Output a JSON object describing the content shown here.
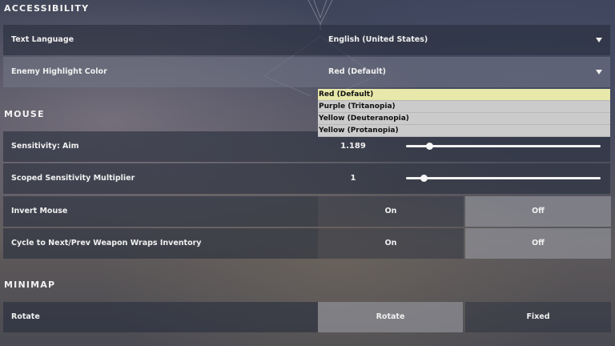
{
  "sections": {
    "accessibility": "ACCESSIBILITY",
    "mouse": "MOUSE",
    "minimap": "MINIMAP"
  },
  "accessibility": {
    "text_language": {
      "label": "Text Language",
      "value": "English (United States)"
    },
    "enemy_highlight": {
      "label": "Enemy Highlight Color",
      "value": "Red (Default)",
      "options": [
        "Red (Default)",
        "Purple (Tritanopia)",
        "Yellow (Deuteranopia)",
        "Yellow (Protanopia)"
      ]
    }
  },
  "mouse": {
    "sensitivity": {
      "label": "Sensitivity: Aim",
      "value": "1.189",
      "fraction": 0.12
    },
    "scoped": {
      "label": "Scoped Sensitivity Multiplier",
      "value": "1",
      "fraction": 0.09
    },
    "invert": {
      "label": "Invert Mouse",
      "on": "On",
      "off": "Off",
      "selected": "Off"
    },
    "cycle": {
      "label": "Cycle to Next/Prev Weapon Wraps Inventory",
      "on": "On",
      "off": "Off",
      "selected": "Off"
    }
  },
  "minimap": {
    "rotate": {
      "label": "Rotate",
      "opt1": "Rotate",
      "opt2": "Fixed",
      "selected": "Rotate"
    }
  },
  "colors": {
    "dropdown_selected": "#e7e8a9",
    "dropdown_bg": "#cbcbcb",
    "row_bg": "#282e3e"
  },
  "icons": [
    "caret-down-icon"
  ]
}
